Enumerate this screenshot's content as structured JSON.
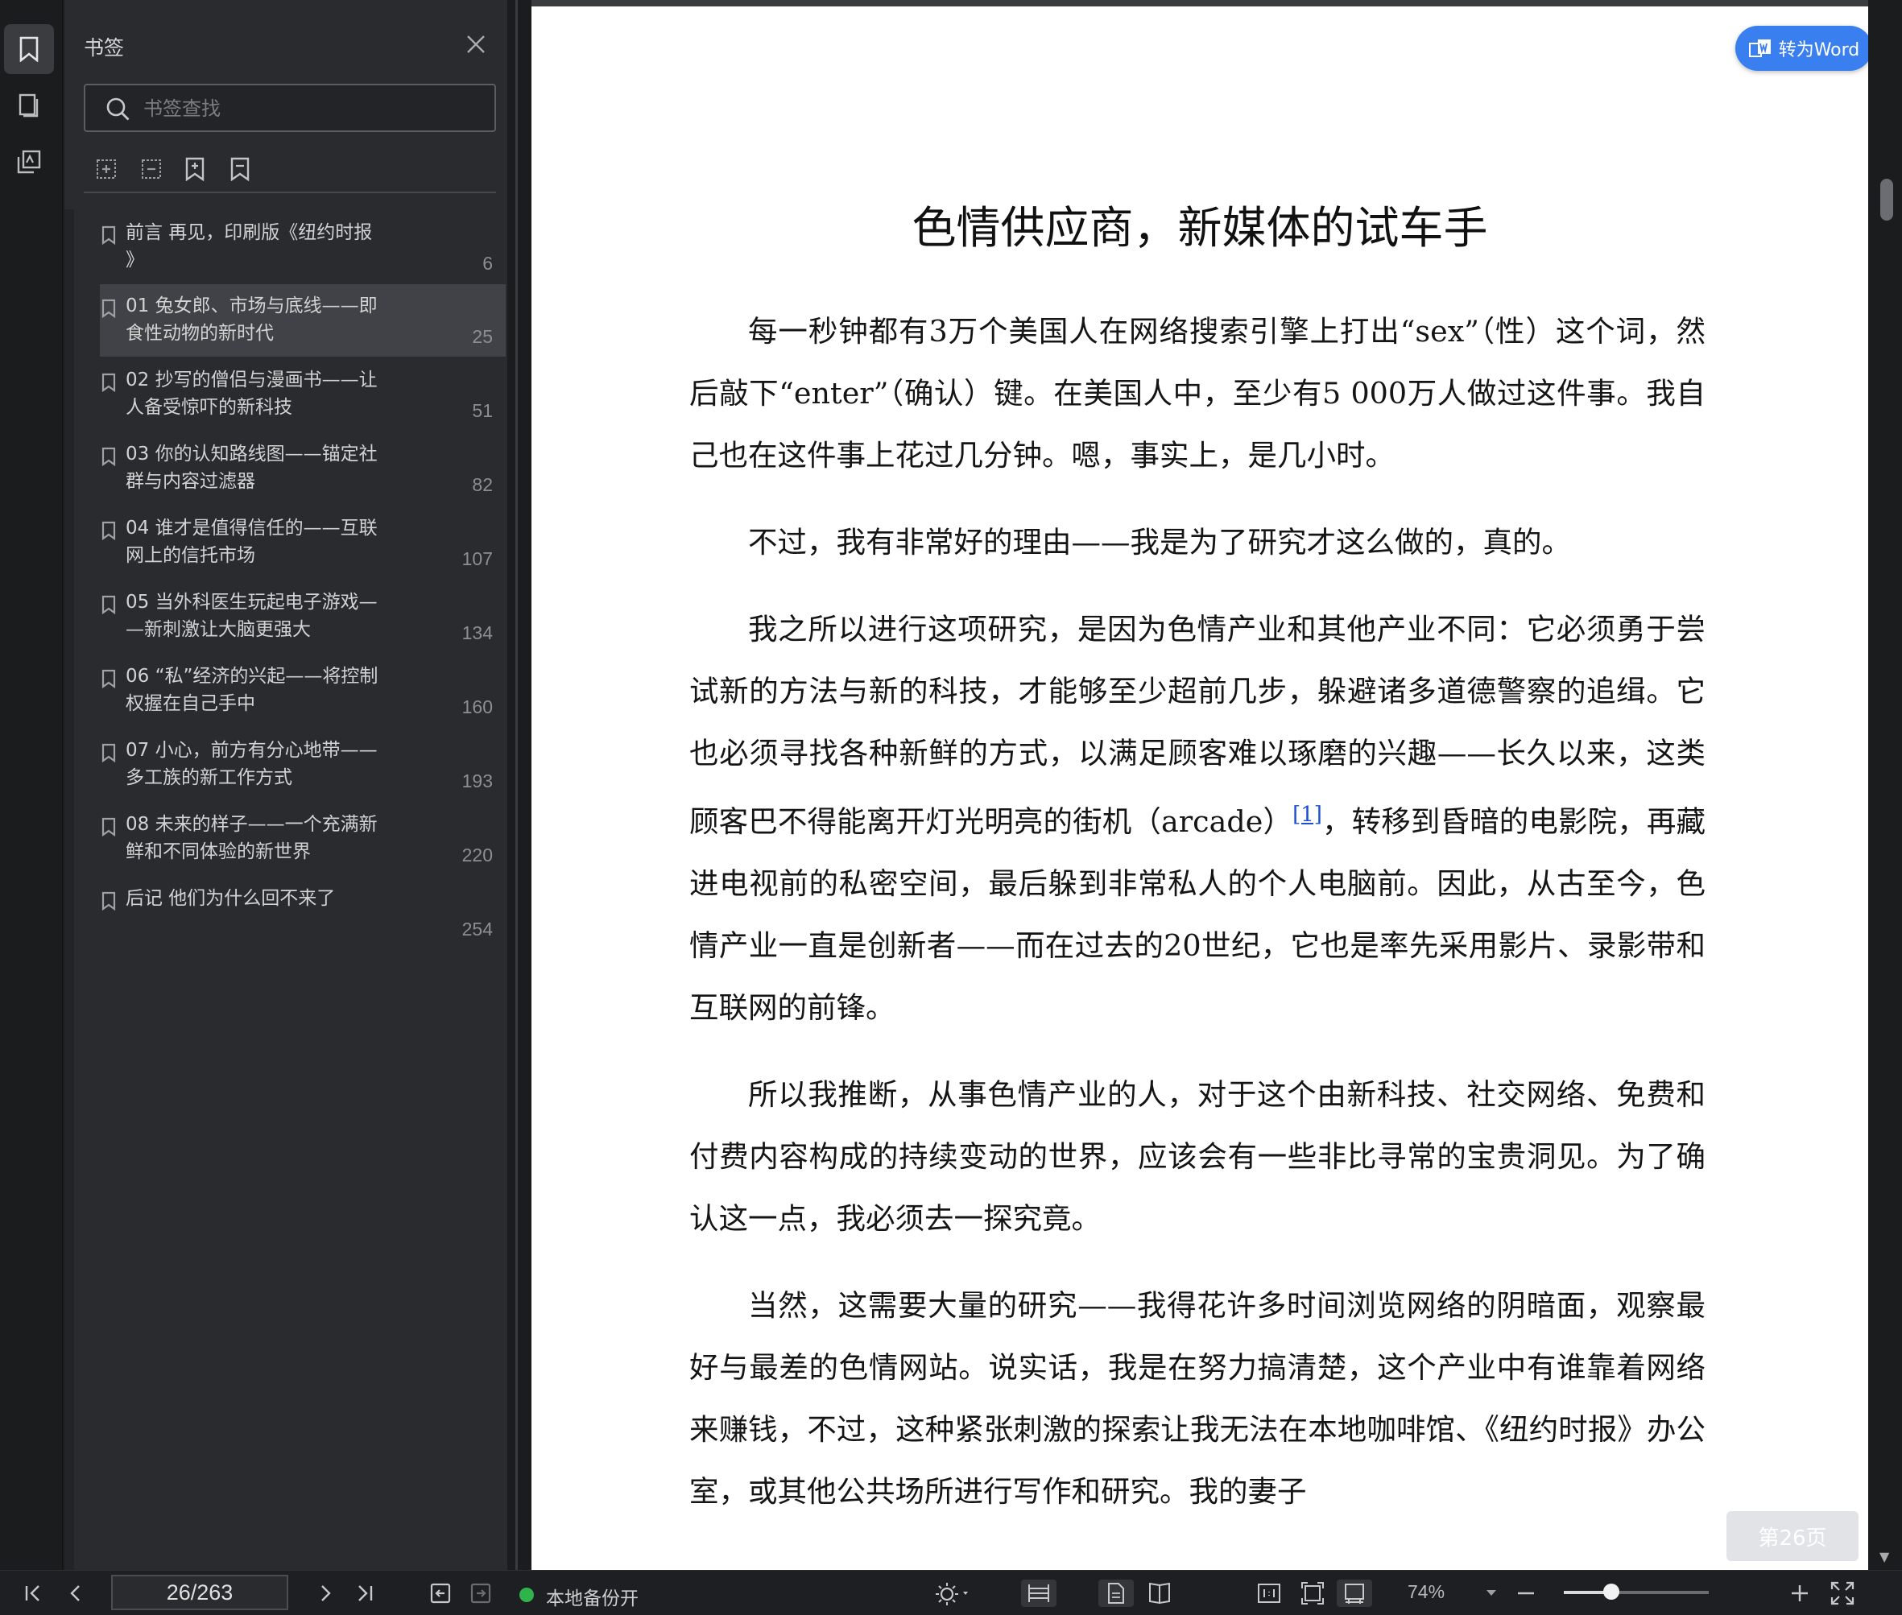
{
  "sidebar": {
    "title": "书签",
    "search_placeholder": "书签查找",
    "bookmarks": [
      {
        "label": "前言 再见，印刷版《纽约时报\n》",
        "page": "6"
      },
      {
        "label": "01 兔女郎、市场与底线——即\n食性动物的新时代",
        "page": "25"
      },
      {
        "label": "02 抄写的僧侣与漫画书——让\n人备受惊吓的新科技",
        "page": "51"
      },
      {
        "label": "03 你的认知路线图——锚定社\n群与内容过滤器",
        "page": "82"
      },
      {
        "label": "04 谁才是值得信任的——互联\n网上的信托市场",
        "page": "107"
      },
      {
        "label": "05 当外科医生玩起电子游戏—\n—新刺激让大脑更强大",
        "page": "134"
      },
      {
        "label": "06 “私”经济的兴起——将控制\n权握在自己手中",
        "page": "160"
      },
      {
        "label": "07 小心，前方有分心地带——\n多工族的新工作方式",
        "page": "193"
      },
      {
        "label": "08 未来的样子——一个充满新\n鲜和不同体验的新世界",
        "page": "220"
      },
      {
        "label": "后记 他们为什么回不来了",
        "page": "254"
      }
    ],
    "selected_index": 1
  },
  "document": {
    "title": "色情供应商，新媒体的试车手",
    "to_word_label": "转为Word",
    "page_badge": "第26页",
    "paragraphs": [
      "每一秒钟都有3万个美国人在网络搜索引擎上打出“sex”（性）这个词，然后敲下“enter”（确认）键。在美国人中，至少有5 000万人做过这件事。我自己也在这件事上花过几分钟。嗯，事实上，是几小时。",
      "不过，我有非常好的理由——我是为了研究才这么做的，真的。",
      "我之所以进行这项研究，是因为色情产业和其他产业不同：它必须勇于尝试新的方法与新的科技，才能够至少超前几步，躲避诸多道德警察的追缉。它也必须寻找各种新鲜的方式，以满足顾客难以琢磨的兴趣——长久以来，这类顾客巴不得能离开灯光明亮的街机（arcade）",
      "所以我推断，从事色情产业的人，对于这个由新科技、社交网络、免费和付费内容构成的持续变动的世界，应该会有一些非比寻常的宝贵洞见。为了确认这一点，我必须去一探究竟。",
      "当然，这需要大量的研究——我得花许多时间浏览网络的阴暗面，观察最好与最差的色情网站。说实话，我是在努力搞清楚，这个产业中有谁靠着网络来赚钱，不过，这种紧张刺激的探索让我无法在本地咖啡馆、《纽约时报》办公室，或其他公共场所进行写作和研究。我的妻子"
    ],
    "footnote": "[1]",
    "para3_tail": "，转移到昏暗的电影院，再藏进电视前的私密空间，最后躲到非常私人的个人电脑前。因此，从古至今，色情产业一直是创新者——而在过去的20世纪，它也是率先采用影片、录影带和互联网的前锋。"
  },
  "statusbar": {
    "page_value": "26/263",
    "backup_label": "本地备份开",
    "zoom_label": "74%",
    "zoom_fraction": 0.33
  },
  "colors": {
    "accent": "#3a7ff0",
    "backup_green": "#2fb34a",
    "panel_bg": "#2a2b2f"
  }
}
